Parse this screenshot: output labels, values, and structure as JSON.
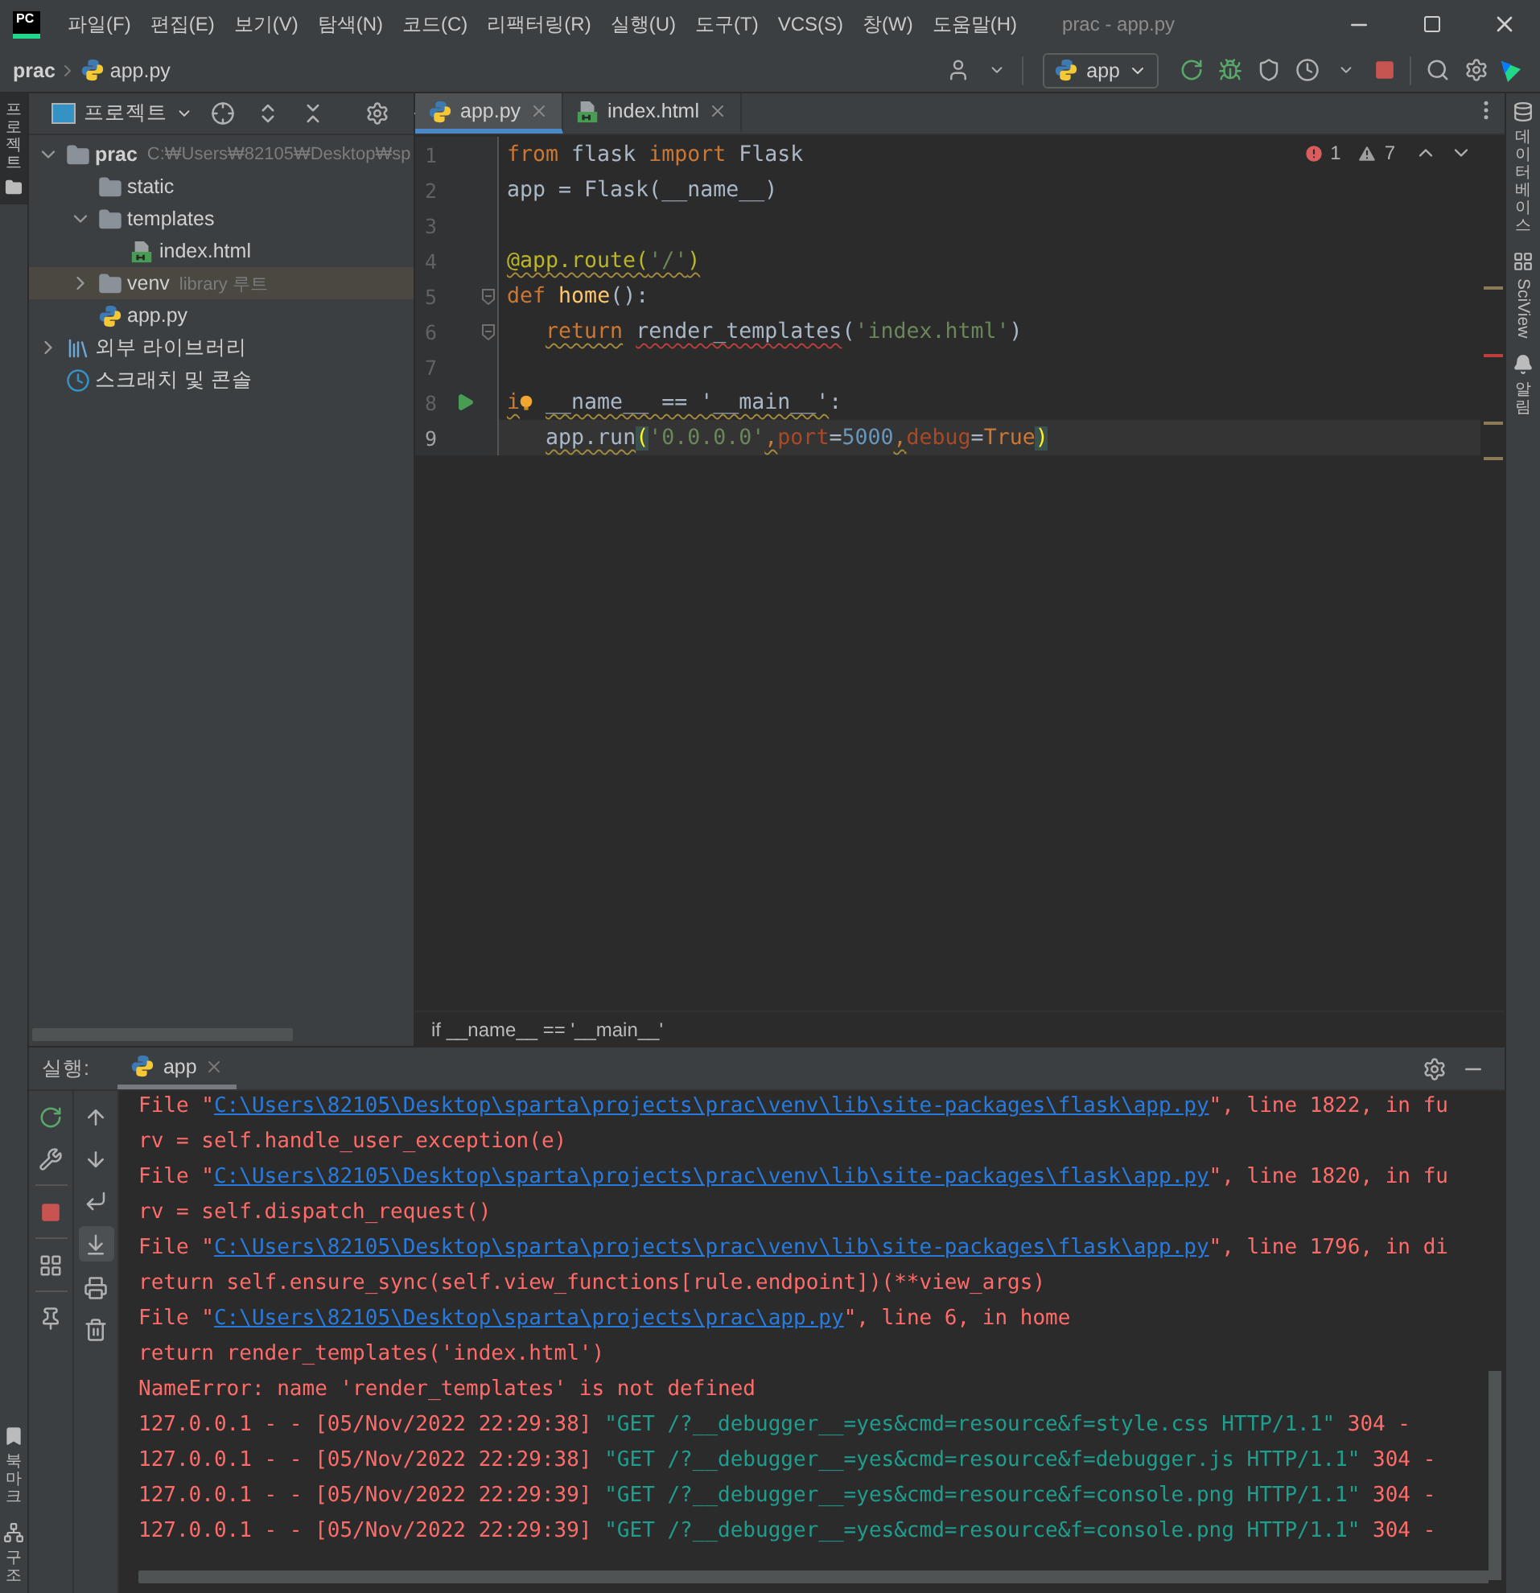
{
  "title_bar": {
    "logo": "PC",
    "menus": [
      "파일(F)",
      "편집(E)",
      "보기(V)",
      "탐색(N)",
      "코드(C)",
      "리팩터링(R)",
      "실행(U)",
      "도구(T)",
      "VCS(S)",
      "창(W)",
      "도움말(H)"
    ],
    "title": "prac - app.py"
  },
  "nav_bar": {
    "breadcrumb": [
      "prac",
      "app.py"
    ],
    "run_config": "app"
  },
  "left_strip": {
    "top_tabs": [
      {
        "label": "프로젝트",
        "selected": true
      }
    ],
    "bottom_tabs": [
      {
        "label": "북마크",
        "kind": "bookmark"
      },
      {
        "label": "구조",
        "kind": "structure"
      }
    ]
  },
  "project_panel": {
    "title": "프로젝트",
    "tree": [
      {
        "label": "prac",
        "kind": "folder",
        "hint": "C:₩Users₩82105₩Desktop₩sp",
        "expanded": true,
        "selected": false,
        "children": [
          {
            "label": "static",
            "kind": "folder",
            "selected": false
          },
          {
            "label": "templates",
            "kind": "folder",
            "expanded": true,
            "selected": false,
            "children": [
              {
                "label": "index.html",
                "kind": "html",
                "selected": false
              }
            ]
          },
          {
            "label": "venv",
            "kind": "folder",
            "hint": "library 루트",
            "expanded": false,
            "selected": true
          },
          {
            "label": "app.py",
            "kind": "python",
            "selected": false
          }
        ]
      },
      {
        "label": "외부 라이브러리",
        "kind": "library",
        "expanded": false,
        "selected": false
      },
      {
        "label": "스크래치 및 콘솔",
        "kind": "scratch",
        "selected": false
      }
    ]
  },
  "editor": {
    "tabs": [
      {
        "label": "app.py",
        "kind": "python",
        "selected": true
      },
      {
        "label": "index.html",
        "kind": "html",
        "selected": false
      }
    ],
    "errors": "1",
    "warnings": "7",
    "lines": [
      {
        "number": "1",
        "current": false,
        "run_marker": false,
        "fold_marker": false,
        "tokens": [
          {
            "text": "from",
            "kind": "keyword"
          },
          {
            "text": " flask ",
            "kind": "plain"
          },
          {
            "text": "import",
            "kind": "keyword"
          },
          {
            "text": " Flask",
            "kind": "plain"
          }
        ]
      },
      {
        "number": "2",
        "current": false,
        "run_marker": false,
        "fold_marker": false,
        "tokens": [
          {
            "text": "app = Flask(__name__)",
            "kind": "plain"
          }
        ]
      },
      {
        "number": "3",
        "current": false,
        "run_marker": false,
        "fold_marker": false
      },
      {
        "number": "4",
        "current": false,
        "run_marker": false,
        "fold_marker": false,
        "tokens": [
          {
            "text": "@app.route(",
            "kind": "decorator",
            "warning": true
          },
          {
            "text": "'/'",
            "kind": "string",
            "warning": true
          },
          {
            "text": ")",
            "kind": "decorator",
            "warning": true
          }
        ]
      },
      {
        "number": "5",
        "current": false,
        "run_marker": false,
        "fold_marker": true,
        "tokens": [
          {
            "text": "def",
            "kind": "keyword"
          },
          {
            "text": " home",
            "kind": "function"
          },
          {
            "text": "():",
            "kind": "plain"
          }
        ]
      },
      {
        "number": "6",
        "current": false,
        "run_marker": false,
        "fold_marker": true,
        "tokens": [
          {
            "text": "   return",
            "kind": "keyword",
            "warning": true
          },
          {
            "text": " render_templates",
            "kind": "plain",
            "error": true
          },
          {
            "text": "(",
            "kind": "plain"
          },
          {
            "text": "'index.html'",
            "kind": "string"
          },
          {
            "text": ")",
            "kind": "plain"
          }
        ]
      },
      {
        "number": "7",
        "current": false,
        "run_marker": false,
        "fold_marker": false
      },
      {
        "number": "8",
        "current": false,
        "run_marker": true,
        "fold_marker": false,
        "tokens": [
          {
            "text": "i",
            "kind": "keyword",
            "warning": true
          },
          {
            "kind": "bulb"
          },
          {
            "text": " __name__ == '__main__'",
            "kind": "plain",
            "warning": true
          },
          {
            "text": ":",
            "kind": "plain"
          }
        ]
      },
      {
        "number": "9",
        "current": true,
        "run_marker": false,
        "fold_marker": false,
        "tokens": [
          {
            "text": "   app.run",
            "kind": "plain",
            "warning": true
          },
          {
            "text": "(",
            "kind": "brace"
          },
          {
            "text": "'0.0.0.0'",
            "kind": "string"
          },
          {
            "text": ",",
            "kind": "keyword",
            "warning": true
          },
          {
            "text": "port",
            "kind": "param"
          },
          {
            "text": "=",
            "kind": "plain"
          },
          {
            "text": "5000",
            "kind": "number"
          },
          {
            "text": ",",
            "kind": "keyword",
            "warning": true
          },
          {
            "text": "debug",
            "kind": "param"
          },
          {
            "text": "=",
            "kind": "plain"
          },
          {
            "text": "True",
            "kind": "keyword"
          },
          {
            "text": ")",
            "kind": "brace"
          }
        ]
      }
    ],
    "breadcrumb": "if __name__ == '__main__'"
  },
  "right_strip": {
    "tabs": [
      {
        "label": "데이터베이스",
        "kind": "database"
      },
      {
        "label": "SciView",
        "kind": "sciview"
      },
      {
        "label": "알림",
        "kind": "bell"
      }
    ]
  },
  "run_panel": {
    "label": "실행:",
    "tabs": [
      {
        "label": "app",
        "selected": true
      }
    ],
    "autoscroll": true,
    "console": [
      {
        "segments": [
          {
            "text": "  File \"",
            "kind": "error"
          },
          {
            "text": "C:\\Users\\82105\\Desktop\\sparta\\projects\\prac\\venv\\lib\\site-packages\\flask\\app.py",
            "kind": "link"
          },
          {
            "text": "\", line 1822, in fu",
            "kind": "error"
          }
        ]
      },
      {
        "segments": [
          {
            "text": "    rv = self.handle_user_exception(e)",
            "kind": "error"
          }
        ]
      },
      {
        "segments": [
          {
            "text": "  File \"",
            "kind": "error"
          },
          {
            "text": "C:\\Users\\82105\\Desktop\\sparta\\projects\\prac\\venv\\lib\\site-packages\\flask\\app.py",
            "kind": "link"
          },
          {
            "text": "\", line 1820, in fu",
            "kind": "error"
          }
        ]
      },
      {
        "segments": [
          {
            "text": "    rv = self.dispatch_request()",
            "kind": "error"
          }
        ]
      },
      {
        "segments": [
          {
            "text": "  File \"",
            "kind": "error"
          },
          {
            "text": "C:\\Users\\82105\\Desktop\\sparta\\projects\\prac\\venv\\lib\\site-packages\\flask\\app.py",
            "kind": "link"
          },
          {
            "text": "\", line 1796, in di",
            "kind": "error"
          }
        ]
      },
      {
        "segments": [
          {
            "text": "    return self.ensure_sync(self.view_functions[rule.endpoint])(**view_args)",
            "kind": "error"
          }
        ]
      },
      {
        "segments": [
          {
            "text": "  File \"",
            "kind": "error"
          },
          {
            "text": "C:\\Users\\82105\\Desktop\\sparta\\projects\\prac\\app.py",
            "kind": "link"
          },
          {
            "text": "\", line 6, in home",
            "kind": "error"
          }
        ]
      },
      {
        "segments": [
          {
            "text": "    return render_templates('index.html')",
            "kind": "error"
          }
        ]
      },
      {
        "segments": [
          {
            "text": "NameError: name 'render_templates' is not defined",
            "kind": "error"
          }
        ]
      },
      {
        "segments": [
          {
            "text": "127.0.0.1 - - [05/Nov/2022 22:29:38] ",
            "kind": "error"
          },
          {
            "text": "\"GET /?__debugger__=yes&cmd=resource&f=style.css HTTP/1.1\"",
            "kind": "http"
          },
          {
            "text": " 304 -",
            "kind": "error"
          }
        ]
      },
      {
        "segments": [
          {
            "text": "127.0.0.1 - - [05/Nov/2022 22:29:38] ",
            "kind": "error"
          },
          {
            "text": "\"GET /?__debugger__=yes&cmd=resource&f=debugger.js HTTP/1.1\"",
            "kind": "http"
          },
          {
            "text": " 304 -",
            "kind": "error"
          }
        ]
      },
      {
        "segments": [
          {
            "text": "127.0.0.1 - - [05/Nov/2022 22:29:39] ",
            "kind": "error"
          },
          {
            "text": "\"GET /?__debugger__=yes&cmd=resource&f=console.png HTTP/1.1\"",
            "kind": "http"
          },
          {
            "text": " 304 -",
            "kind": "error"
          }
        ]
      },
      {
        "segments": [
          {
            "text": "127.0.0.1 - - [05/Nov/2022 22:29:39] ",
            "kind": "error"
          },
          {
            "text": "\"GET /?__debugger__=yes&cmd=resource&f=console.png HTTP/1.1\"",
            "kind": "http"
          },
          {
            "text": " 304 -",
            "kind": "error"
          }
        ]
      }
    ]
  }
}
